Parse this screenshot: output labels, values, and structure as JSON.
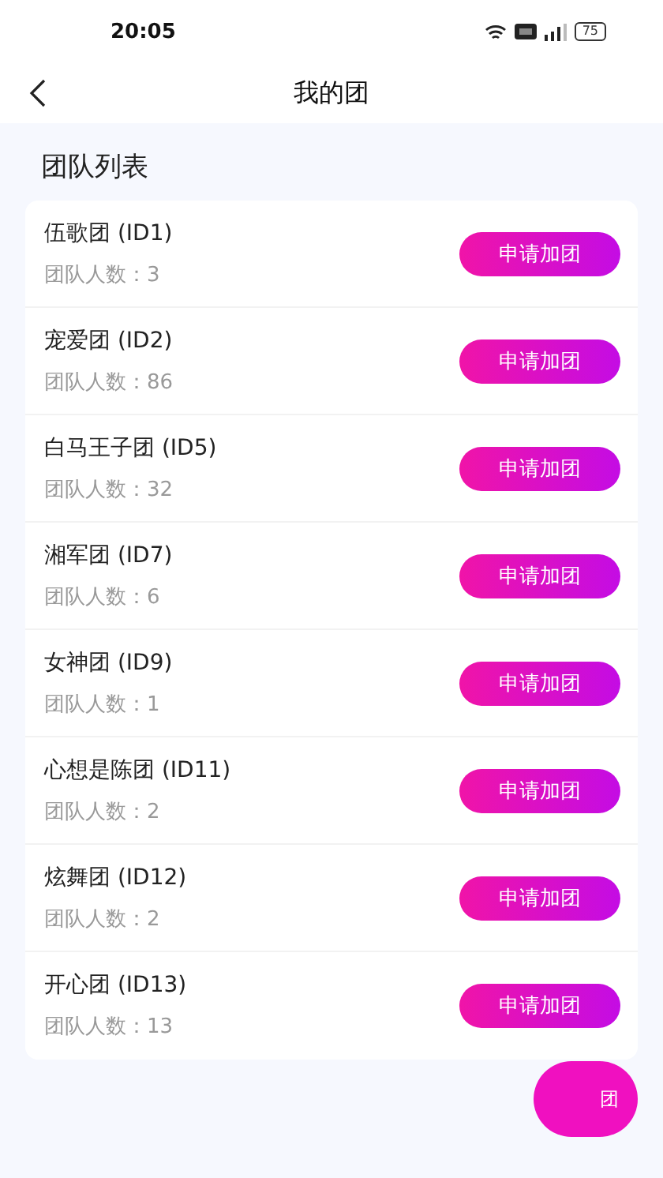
{
  "status_bar": {
    "time": "20:05",
    "battery": "75"
  },
  "header": {
    "title": "我的团"
  },
  "section_title": "团队列表",
  "teams": [
    {
      "name": "伍歌团 (ID1)",
      "members": "团队人数：3",
      "action": "申请加团"
    },
    {
      "name": "宠爱团 (ID2)",
      "members": "团队人数：86",
      "action": "申请加团"
    },
    {
      "name": "白马王子团 (ID5)",
      "members": "团队人数：32",
      "action": "申请加团"
    },
    {
      "name": "湘军团 (ID7)",
      "members": "团队人数：6",
      "action": "申请加团"
    },
    {
      "name": "女神团 (ID9)",
      "members": "团队人数：1",
      "action": "申请加团"
    },
    {
      "name": "心想是陈团 (ID11)",
      "members": "团队人数：2",
      "action": "申请加团"
    },
    {
      "name": "炫舞团 (ID12)",
      "members": "团队人数：2",
      "action": "申请加团"
    },
    {
      "name": "开心团 (ID13)",
      "members": "团队人数：13",
      "action": "申请加团"
    }
  ],
  "floating_button": {
    "label": "团"
  }
}
